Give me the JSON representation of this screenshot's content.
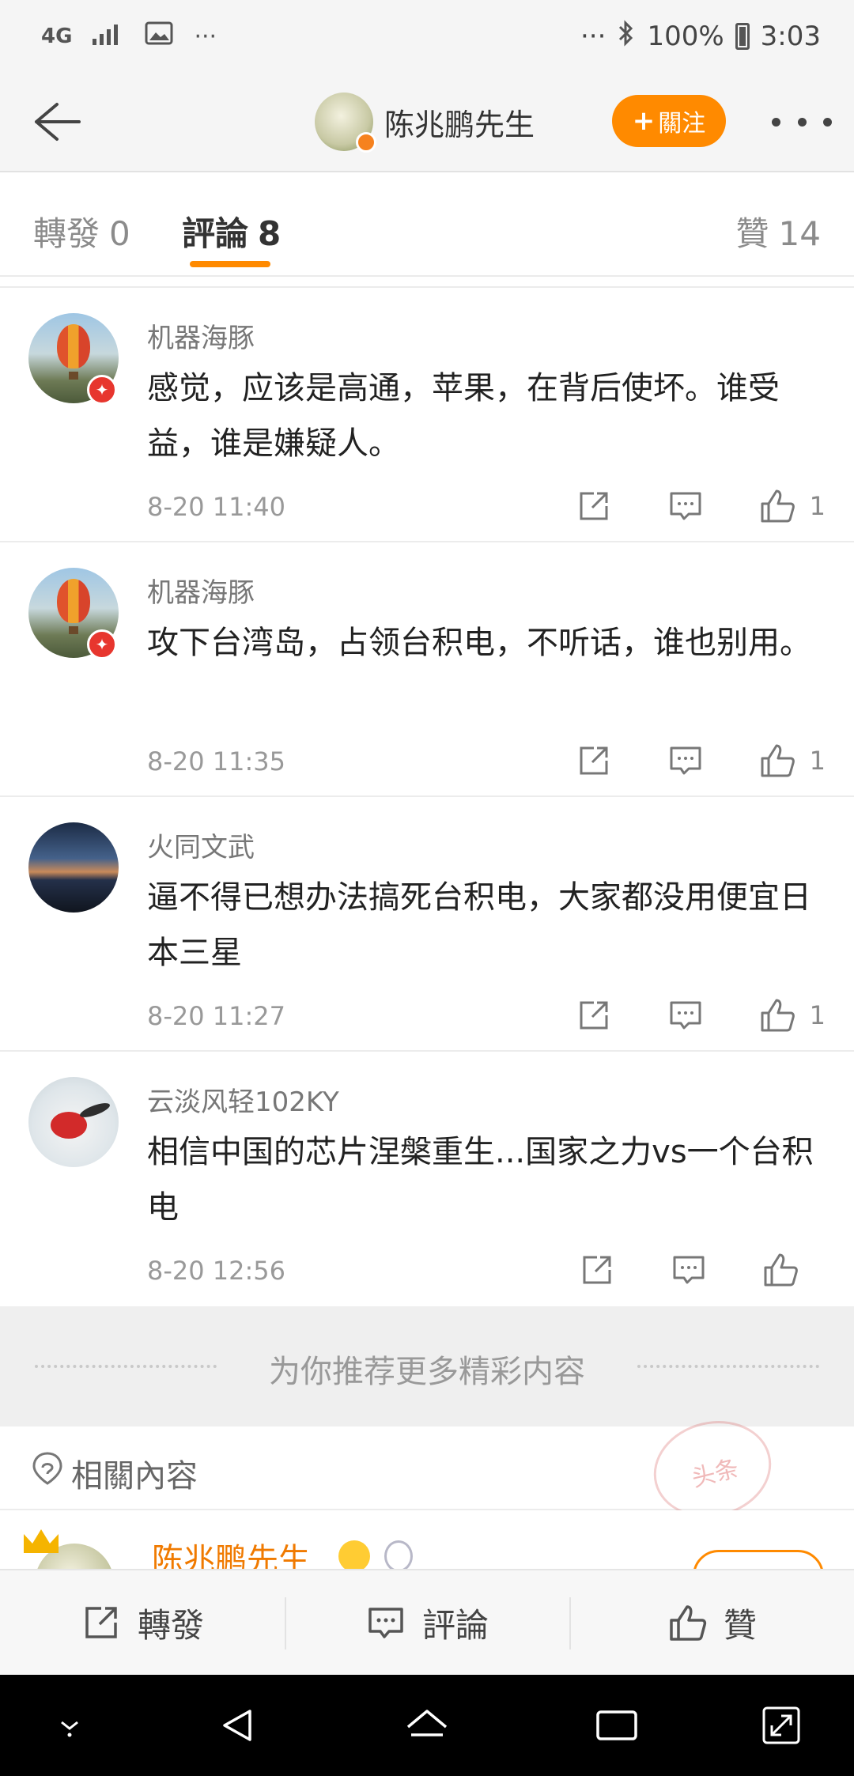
{
  "status_bar": {
    "network": "4G",
    "icons": [
      "signal-icon",
      "gallery-icon",
      "more-dots-icon",
      "bluetooth-icon",
      "battery-icon"
    ],
    "left_more": "···",
    "right_more": "···",
    "battery": "100%",
    "time": "3:03"
  },
  "header": {
    "name": "陈兆鹏先生",
    "follow_label": "關注",
    "follow_plus": "+"
  },
  "tabs": {
    "repost_label": "轉發",
    "repost_count": "0",
    "comment_label": "評論",
    "comment_count": "8",
    "like_label": "贊",
    "like_count": "14"
  },
  "comments": [
    {
      "user": "机器海豚",
      "text": "感觉，应该是高通，苹果，在背后使坏。谁受益，谁是嫌疑人。",
      "time": "8-20 11:40",
      "likes": "1"
    },
    {
      "user": "机器海豚",
      "text": "攻下台湾岛，占领台积电，不听话，谁也别用。",
      "time": "8-20 11:35",
      "likes": "1"
    },
    {
      "user": "火同文武",
      "text": "逼不得已想办法搞死台积电，大家都没用便宜日本三星",
      "time": "8-20 11:27",
      "likes": "1"
    },
    {
      "user": "云淡风轻102KY",
      "text": "相信中国的芯片涅槃重生...国家之力vs一个台积电",
      "time": "8-20 12:56",
      "likes": ""
    }
  ],
  "recommend": {
    "text": "为你推荐更多精彩内容"
  },
  "related": {
    "title": "相關內容",
    "stamp_text": "头条",
    "peek_name": "陈兆鹏先生"
  },
  "action_bar": {
    "repost": "轉發",
    "comment": "評論",
    "like": "贊"
  },
  "colors": {
    "accent": "#ff8a00",
    "badge_red": "#e7362e"
  }
}
